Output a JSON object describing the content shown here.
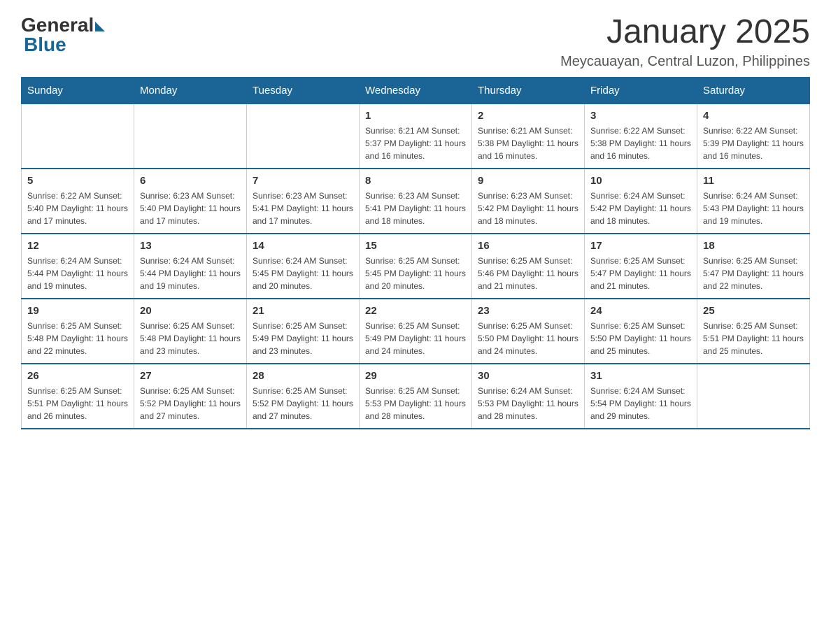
{
  "logo": {
    "general": "General",
    "blue": "Blue"
  },
  "title": "January 2025",
  "subtitle": "Meycauayan, Central Luzon, Philippines",
  "days_of_week": [
    "Sunday",
    "Monday",
    "Tuesday",
    "Wednesday",
    "Thursday",
    "Friday",
    "Saturday"
  ],
  "weeks": [
    [
      {
        "day": "",
        "info": ""
      },
      {
        "day": "",
        "info": ""
      },
      {
        "day": "",
        "info": ""
      },
      {
        "day": "1",
        "info": "Sunrise: 6:21 AM\nSunset: 5:37 PM\nDaylight: 11 hours and 16 minutes."
      },
      {
        "day": "2",
        "info": "Sunrise: 6:21 AM\nSunset: 5:38 PM\nDaylight: 11 hours and 16 minutes."
      },
      {
        "day": "3",
        "info": "Sunrise: 6:22 AM\nSunset: 5:38 PM\nDaylight: 11 hours and 16 minutes."
      },
      {
        "day": "4",
        "info": "Sunrise: 6:22 AM\nSunset: 5:39 PM\nDaylight: 11 hours and 16 minutes."
      }
    ],
    [
      {
        "day": "5",
        "info": "Sunrise: 6:22 AM\nSunset: 5:40 PM\nDaylight: 11 hours and 17 minutes."
      },
      {
        "day": "6",
        "info": "Sunrise: 6:23 AM\nSunset: 5:40 PM\nDaylight: 11 hours and 17 minutes."
      },
      {
        "day": "7",
        "info": "Sunrise: 6:23 AM\nSunset: 5:41 PM\nDaylight: 11 hours and 17 minutes."
      },
      {
        "day": "8",
        "info": "Sunrise: 6:23 AM\nSunset: 5:41 PM\nDaylight: 11 hours and 18 minutes."
      },
      {
        "day": "9",
        "info": "Sunrise: 6:23 AM\nSunset: 5:42 PM\nDaylight: 11 hours and 18 minutes."
      },
      {
        "day": "10",
        "info": "Sunrise: 6:24 AM\nSunset: 5:42 PM\nDaylight: 11 hours and 18 minutes."
      },
      {
        "day": "11",
        "info": "Sunrise: 6:24 AM\nSunset: 5:43 PM\nDaylight: 11 hours and 19 minutes."
      }
    ],
    [
      {
        "day": "12",
        "info": "Sunrise: 6:24 AM\nSunset: 5:44 PM\nDaylight: 11 hours and 19 minutes."
      },
      {
        "day": "13",
        "info": "Sunrise: 6:24 AM\nSunset: 5:44 PM\nDaylight: 11 hours and 19 minutes."
      },
      {
        "day": "14",
        "info": "Sunrise: 6:24 AM\nSunset: 5:45 PM\nDaylight: 11 hours and 20 minutes."
      },
      {
        "day": "15",
        "info": "Sunrise: 6:25 AM\nSunset: 5:45 PM\nDaylight: 11 hours and 20 minutes."
      },
      {
        "day": "16",
        "info": "Sunrise: 6:25 AM\nSunset: 5:46 PM\nDaylight: 11 hours and 21 minutes."
      },
      {
        "day": "17",
        "info": "Sunrise: 6:25 AM\nSunset: 5:47 PM\nDaylight: 11 hours and 21 minutes."
      },
      {
        "day": "18",
        "info": "Sunrise: 6:25 AM\nSunset: 5:47 PM\nDaylight: 11 hours and 22 minutes."
      }
    ],
    [
      {
        "day": "19",
        "info": "Sunrise: 6:25 AM\nSunset: 5:48 PM\nDaylight: 11 hours and 22 minutes."
      },
      {
        "day": "20",
        "info": "Sunrise: 6:25 AM\nSunset: 5:48 PM\nDaylight: 11 hours and 23 minutes."
      },
      {
        "day": "21",
        "info": "Sunrise: 6:25 AM\nSunset: 5:49 PM\nDaylight: 11 hours and 23 minutes."
      },
      {
        "day": "22",
        "info": "Sunrise: 6:25 AM\nSunset: 5:49 PM\nDaylight: 11 hours and 24 minutes."
      },
      {
        "day": "23",
        "info": "Sunrise: 6:25 AM\nSunset: 5:50 PM\nDaylight: 11 hours and 24 minutes."
      },
      {
        "day": "24",
        "info": "Sunrise: 6:25 AM\nSunset: 5:50 PM\nDaylight: 11 hours and 25 minutes."
      },
      {
        "day": "25",
        "info": "Sunrise: 6:25 AM\nSunset: 5:51 PM\nDaylight: 11 hours and 25 minutes."
      }
    ],
    [
      {
        "day": "26",
        "info": "Sunrise: 6:25 AM\nSunset: 5:51 PM\nDaylight: 11 hours and 26 minutes."
      },
      {
        "day": "27",
        "info": "Sunrise: 6:25 AM\nSunset: 5:52 PM\nDaylight: 11 hours and 27 minutes."
      },
      {
        "day": "28",
        "info": "Sunrise: 6:25 AM\nSunset: 5:52 PM\nDaylight: 11 hours and 27 minutes."
      },
      {
        "day": "29",
        "info": "Sunrise: 6:25 AM\nSunset: 5:53 PM\nDaylight: 11 hours and 28 minutes."
      },
      {
        "day": "30",
        "info": "Sunrise: 6:24 AM\nSunset: 5:53 PM\nDaylight: 11 hours and 28 minutes."
      },
      {
        "day": "31",
        "info": "Sunrise: 6:24 AM\nSunset: 5:54 PM\nDaylight: 11 hours and 29 minutes."
      },
      {
        "day": "",
        "info": ""
      }
    ]
  ]
}
